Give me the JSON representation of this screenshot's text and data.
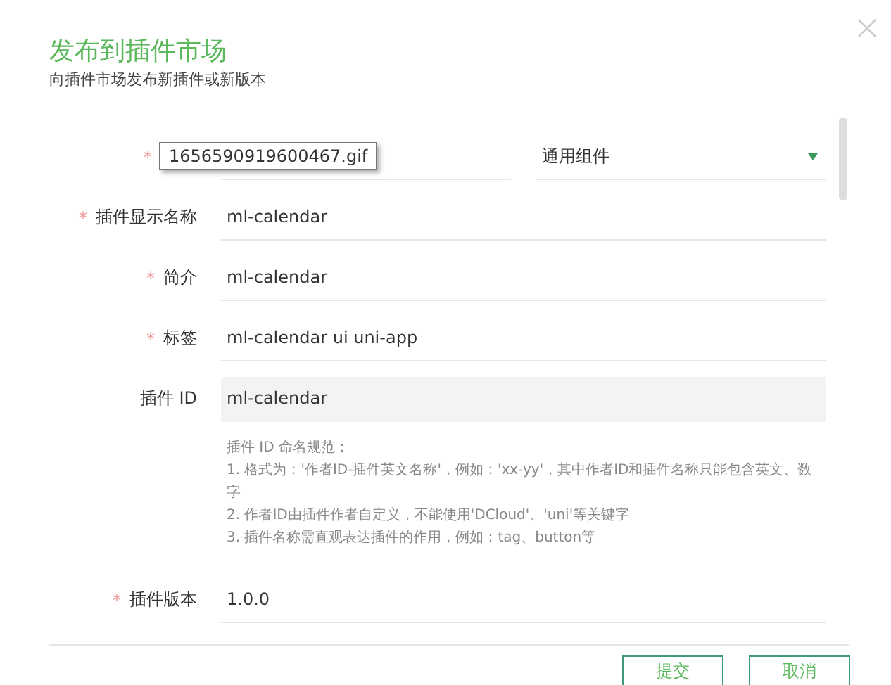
{
  "dialog": {
    "title": "发布到插件市场",
    "subtitle": "向插件市场发布新插件或新版本"
  },
  "form": {
    "rows": [
      {
        "kind": "select-pair",
        "mark": "*",
        "selects": [
          {
            "kind": "covered"
          },
          {
            "kind": "select",
            "value": "通用组件"
          }
        ]
      },
      {
        "kind": "input",
        "label": "插件显示名称",
        "mark": "*",
        "value": "ml-calendar"
      },
      {
        "kind": "input",
        "label": "简介",
        "mark": "*",
        "value": "ml-calendar"
      },
      {
        "kind": "input",
        "label": "标签",
        "mark": "*",
        "value": "ml-calendar ui uni-app"
      },
      {
        "kind": "readonly",
        "label": "插件 ID",
        "value": "ml-calendar"
      },
      {
        "kind": "hint",
        "lines": [
          "插件 ID 命名规范：",
          "1. 格式为：'作者ID-插件英文名称'，例如：'xx-yy'，其中作者ID和插件名称只能包含英文、数字",
          "2. 作者ID由插件作者自定义，不能使用'DCloud'、'uni'等关键字",
          "3. 插件名称需直观表达插件的作用，例如：tag、button等"
        ]
      },
      {
        "kind": "input",
        "label": "插件版本",
        "mark": "*",
        "value": "1.0.0"
      }
    ]
  },
  "tooltip": "1656590919600467.gif",
  "buttons": [
    "提交",
    "取消"
  ]
}
